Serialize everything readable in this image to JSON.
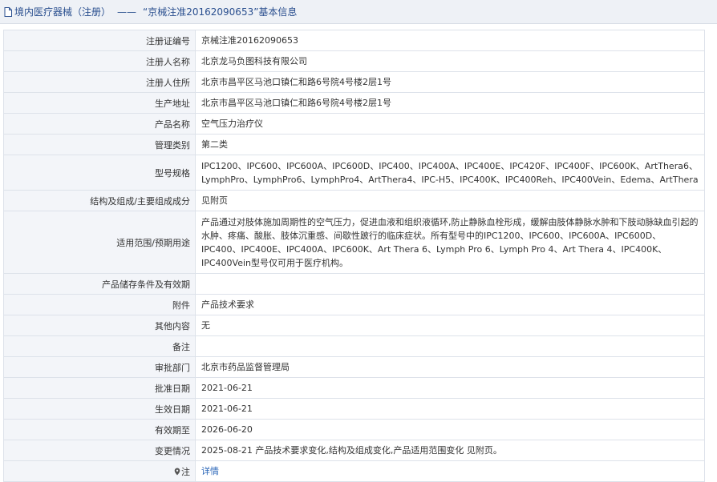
{
  "header": {
    "crumb": "境内医疗器械（注册）",
    "separator": "——",
    "title": "“京械注准20162090653”基本信息"
  },
  "rows": [
    {
      "label": "注册证编号",
      "value": "京械注准20162090653"
    },
    {
      "label": "注册人名称",
      "value": "北京龙马负图科技有限公司"
    },
    {
      "label": "注册人住所",
      "value": "北京市昌平区马池口镇仁和路6号院4号楼2层1号"
    },
    {
      "label": "生产地址",
      "value": "北京市昌平区马池口镇仁和路6号院4号楼2层1号"
    },
    {
      "label": "产品名称",
      "value": "空气压力治疗仪"
    },
    {
      "label": "管理类别",
      "value": "第二类"
    },
    {
      "label": "型号规格",
      "value": "IPC1200、IPC600、IPC600A、IPC600D、IPC400、IPC400A、IPC400E、IPC420F、IPC400F、IPC600K、ArtThera6、LymphPro、LymphPro6、LymphPro4、ArtThera4、IPC-H5、IPC400K、IPC400Reh、IPC400Vein、Edema、ArtThera"
    },
    {
      "label": "结构及组成/主要组成成分",
      "value": "见附页"
    },
    {
      "label": "适用范围/预期用途",
      "value": "产品通过对肢体施加周期性的空气压力，促进血液和组织液循环,防止静脉血栓形成，缓解由肢体静脉水肿和下肢动脉缺血引起的水肿、疼痛、酸胀、肢体沉重感、间歇性跛行的临床症状。所有型号中的IPC1200、IPC600、IPC600A、IPC600D、IPC400、IPC400E、IPC400A、IPC600K、Art Thera 6、Lymph Pro 6、Lymph Pro 4、Art Thera 4、IPC400K、IPC400Vein型号仅可用于医疗机构。"
    },
    {
      "label": "产品储存条件及有效期",
      "value": ""
    },
    {
      "label": "附件",
      "value": "产品技术要求"
    },
    {
      "label": "其他内容",
      "value": "无"
    },
    {
      "label": "备注",
      "value": ""
    },
    {
      "label": "审批部门",
      "value": "北京市药品监督管理局"
    },
    {
      "label": "批准日期",
      "value": "2021-06-21"
    },
    {
      "label": "生效日期",
      "value": "2021-06-21"
    },
    {
      "label": "有效期至",
      "value": "2026-06-20"
    },
    {
      "label": "变更情况",
      "value": "2025-08-21 产品技术要求变化,结构及组成变化,产品适用范围变化 见附页。"
    },
    {
      "label": "注",
      "value": "详情",
      "label_icon": "map-pin-icon"
    }
  ]
}
